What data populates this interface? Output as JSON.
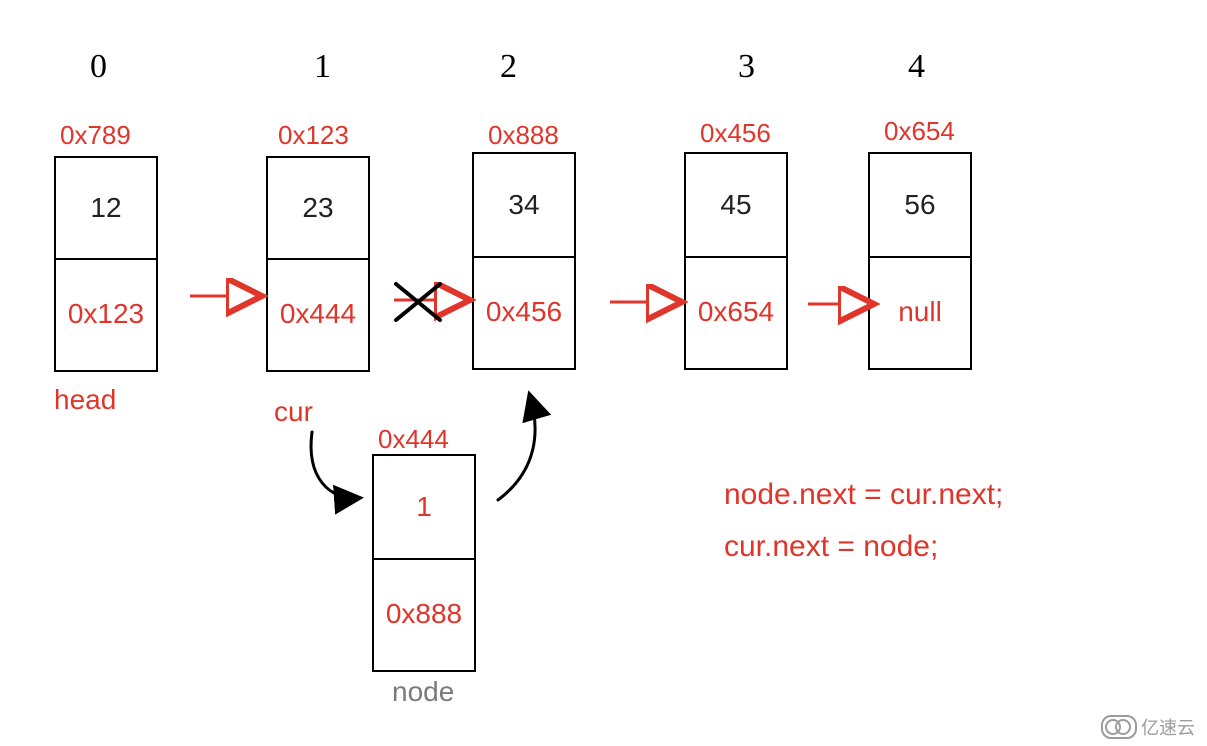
{
  "indices": [
    "0",
    "1",
    "2",
    "3",
    "4"
  ],
  "nodes": [
    {
      "addr": "0x789",
      "value": "12",
      "next": "0x123",
      "label": "head"
    },
    {
      "addr": "0x123",
      "value": "23",
      "next": "0x444",
      "label": "cur"
    },
    {
      "addr": "0x888",
      "value": "34",
      "next": "0x456",
      "label": ""
    },
    {
      "addr": "0x456",
      "value": "45",
      "next": "0x654",
      "label": ""
    },
    {
      "addr": "0x654",
      "value": "56",
      "next": "null",
      "label": ""
    }
  ],
  "insertedNode": {
    "addr": "0x444",
    "value": "1",
    "next": "0x888",
    "label": "node"
  },
  "code": {
    "line1": "node.next = cur.next;",
    "line2": "cur.next = node;"
  },
  "watermark": "亿速云",
  "colors": {
    "accent": "#e0352b",
    "text": "#222222",
    "muted": "#7a7a7a"
  }
}
